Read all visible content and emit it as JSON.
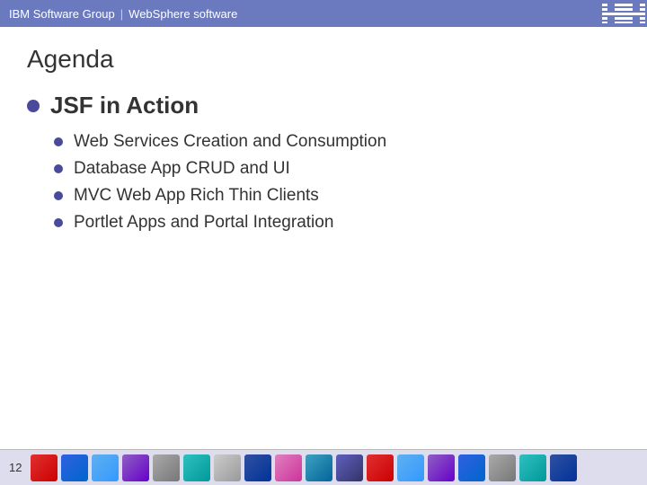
{
  "header": {
    "brand": "IBM Software Group",
    "separator": "|",
    "product": "WebSphere software"
  },
  "slide": {
    "title": "Agenda",
    "sections": [
      {
        "heading": "JSF in Action",
        "items": [
          "Web Services Creation and Consumption",
          "Database App CRUD and UI",
          "MVC Web App Rich Thin Clients",
          "Portlet Apps and Portal Integration"
        ]
      }
    ]
  },
  "footer": {
    "page_number": "12"
  }
}
